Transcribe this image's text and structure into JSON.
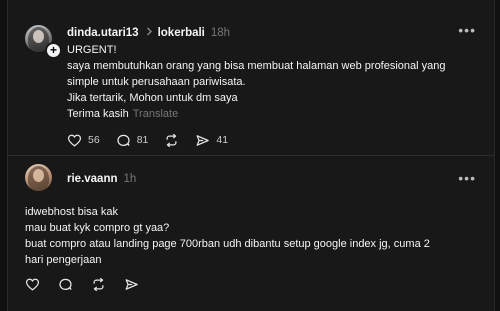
{
  "posts": [
    {
      "username": "dinda.utari13",
      "community": "lokerbali",
      "time": "18h",
      "lines": [
        "URGENT!",
        "saya membutuhkan orang yang bisa membuat halaman web profesional yang",
        "simple untuk perusahaan pariwisata.",
        "Jika tertarik, Mohon untuk dm saya",
        "Terima kasih"
      ],
      "translate_label": "Translate",
      "likes": "56",
      "replies": "81",
      "shares": "41"
    },
    {
      "username": "rie.vaann",
      "time": "1h",
      "lines": [
        "idwebhost bisa kak",
        "mau buat kyk compro gt yaa?",
        "buat compro atau landing page 700rban udh dibantu setup google index jg, cuma 2",
        "hari pengerjaan"
      ]
    }
  ],
  "icons": {
    "like": "heart-icon",
    "reply": "comment-icon",
    "repost": "repost-icon",
    "share": "send-icon",
    "more": "more-icon",
    "community_separator": "chevron-right-icon"
  },
  "colors": {
    "background": "#101010",
    "card": "#181818",
    "text": "#f3f5f7",
    "muted": "#777777"
  }
}
